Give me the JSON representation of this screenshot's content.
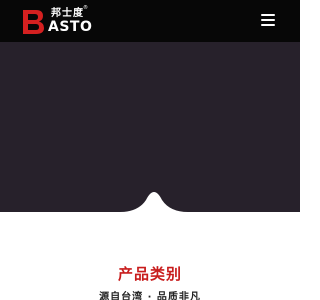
{
  "header": {
    "logo": {
      "chinese_text": "邦士度",
      "registered_mark": "®",
      "english_text": "ASTO",
      "brand_letter": "B"
    },
    "menu_icon": "hamburger-menu-icon"
  },
  "section": {
    "title": "产品类别",
    "subtitle": "源自台湾 · 品质非凡"
  },
  "colors": {
    "header_bg": "#070707",
    "hero_bg": "#27212b",
    "brand_red": "#c81c1c",
    "accent_red": "#d42020"
  }
}
